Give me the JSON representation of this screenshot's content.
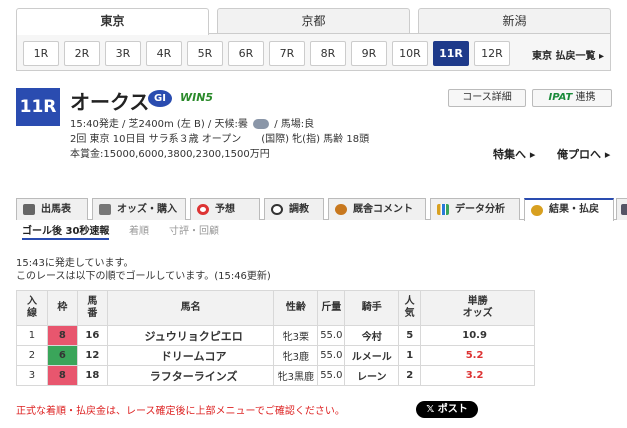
{
  "venues": [
    {
      "label": "東京",
      "active": true
    },
    {
      "label": "京都",
      "active": false
    },
    {
      "label": "新潟",
      "active": false
    }
  ],
  "races": [
    "1R",
    "2R",
    "3R",
    "4R",
    "5R",
    "6R",
    "7R",
    "8R",
    "9R",
    "10R",
    "11R",
    "12R"
  ],
  "active_race": "11R",
  "refund_link": "東京 払戻一覧 ▸",
  "race": {
    "number": "11R",
    "name": "オークス",
    "grade": "GI",
    "win5": "WIN5",
    "line1_a": "15:40発走 / 芝2400m (左 B) / 天候:曇",
    "line1_b": "/ 馬場:良",
    "line2": "2回 東京 10日目 サラ系３歳 オープン　　(国際) 牝(指) 馬齢 18頭",
    "line3": "本賞金:15000,6000,3800,2300,1500万円"
  },
  "buttons": {
    "course": "コース詳細",
    "ipat_logo": "IPAT",
    "ipat_label": "連携"
  },
  "feature_links": {
    "special": "特集へ ▸",
    "pro": "俺プロへ ▸"
  },
  "page_tabs": [
    {
      "label": "出馬表",
      "icon": "table-icon",
      "color": "#555"
    },
    {
      "label": "オッズ・購入",
      "icon": "odds-icon",
      "color": "#555"
    },
    {
      "label": "予想",
      "icon": "target-icon",
      "color": "#d33"
    },
    {
      "label": "調教",
      "icon": "stopwatch-icon",
      "color": "#333"
    },
    {
      "label": "厩舎コメント",
      "icon": "person-icon",
      "color": "#c8781e"
    },
    {
      "label": "データ分析",
      "icon": "bar-chart-icon",
      "color": "#d8a020"
    },
    {
      "label": "結果・払戻",
      "icon": "coins-icon",
      "color": "#d8a020",
      "active": true
    }
  ],
  "sub_tabs": [
    {
      "label": "ゴール後 30秒速報",
      "active": true
    },
    {
      "label": "着順",
      "active": false
    },
    {
      "label": "寸評・回顧",
      "active": false
    }
  ],
  "status": {
    "start": "15:43に発走しています。",
    "goal": "このレースは以下の順でゴールしています。(15:46更新)"
  },
  "table": {
    "headers": [
      "入線",
      "枠",
      "馬番",
      "馬名",
      "性齢",
      "斤量",
      "騎手",
      "人気",
      "単勝オッズ"
    ],
    "headers_display": [
      [
        "入",
        "線"
      ],
      [
        "枠"
      ],
      [
        "馬",
        "番"
      ],
      [
        "馬名"
      ],
      [
        "性齢"
      ],
      [
        "斤量"
      ],
      [
        "騎手"
      ],
      [
        "人",
        "気"
      ],
      [
        "単勝",
        "オッズ"
      ]
    ],
    "rows": [
      {
        "pos": "1",
        "frame": "8",
        "frame_color": "#e8566e",
        "num": "16",
        "horse": "ジュウリョクピエロ",
        "sex_age": "牝3栗",
        "weight": "55.0",
        "jockey": "今村",
        "pop": "5",
        "odds": "10.9",
        "odds_color": "#333"
      },
      {
        "pos": "2",
        "frame": "6",
        "frame_color": "#3aa55a",
        "num": "12",
        "horse": "ドリームコア",
        "sex_age": "牝3鹿",
        "weight": "55.0",
        "jockey": "ルメール",
        "pop": "1",
        "odds": "5.2",
        "odds_color": "#d33"
      },
      {
        "pos": "3",
        "frame": "8",
        "frame_color": "#e8566e",
        "num": "18",
        "horse": "ラフターラインズ",
        "sex_age": "牝3黒鹿",
        "weight": "55.0",
        "jockey": "レーン",
        "pop": "2",
        "odds": "3.2",
        "odds_color": "#d33"
      }
    ]
  },
  "notice": "正式な着順・払戻金は、レース確定後に上部メニューでご確認ください。",
  "x_post": "𝕏 ポスト"
}
